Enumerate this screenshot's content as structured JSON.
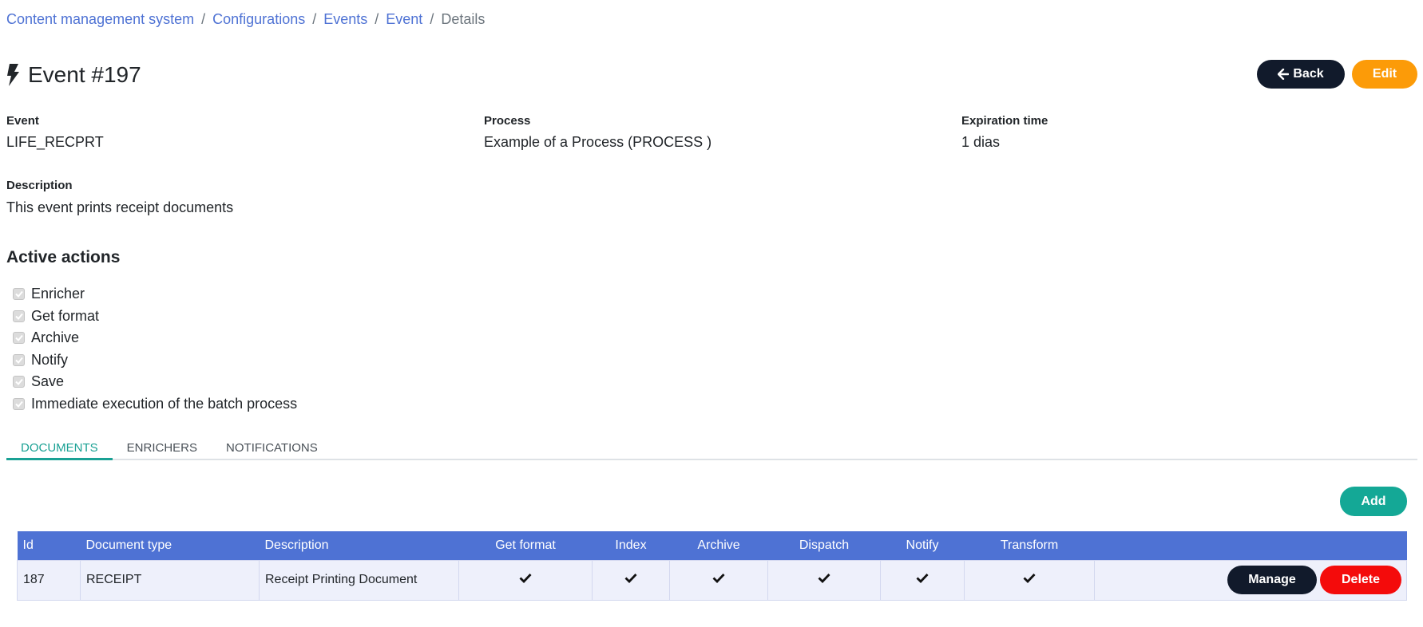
{
  "breadcrumb": {
    "items": [
      "Content management system",
      "Configurations",
      "Events",
      "Event"
    ],
    "current": "Details",
    "separator": "/"
  },
  "page": {
    "title": "Event #197",
    "title_icon": "bolt-icon"
  },
  "header_buttons": {
    "back_label": "Back",
    "back_icon": "arrow-left-icon",
    "edit_label": "Edit"
  },
  "fields": {
    "event_label": "Event",
    "event_value": "LIFE_RECPRT",
    "process_label": "Process",
    "process_value": "Example of a Process (PROCESS )",
    "expiration_label": "Expiration time",
    "expiration_value": "1 dias",
    "description_label": "Description",
    "description_value": "This event prints receipt documents"
  },
  "active_actions": {
    "title": "Active actions",
    "items": [
      {
        "label": "Enricher",
        "checked": true,
        "disabled": true
      },
      {
        "label": "Get format",
        "checked": true,
        "disabled": true
      },
      {
        "label": "Archive",
        "checked": true,
        "disabled": true
      },
      {
        "label": "Notify",
        "checked": true,
        "disabled": true
      },
      {
        "label": "Save",
        "checked": true,
        "disabled": true
      },
      {
        "label": "Immediate execution of the batch process",
        "checked": true,
        "disabled": true
      }
    ]
  },
  "tabs": [
    {
      "label": "DOCUMENTS",
      "active": true
    },
    {
      "label": "ENRICHERS",
      "active": false
    },
    {
      "label": "NOTIFICATIONS",
      "active": false
    }
  ],
  "add_label": "Add",
  "table": {
    "columns": [
      "Id",
      "Document type",
      "Description",
      "Get format",
      "Index",
      "Archive",
      "Dispatch",
      "Notify",
      "Transform",
      ""
    ],
    "rows": [
      {
        "id": "187",
        "document_type": "RECEIPT",
        "description": "Receipt Printing Document",
        "get_format": true,
        "index": true,
        "archive": true,
        "dispatch": true,
        "notify": true,
        "transform": true,
        "manage_label": "Manage",
        "delete_label": "Delete"
      }
    ]
  },
  "colors": {
    "link": "#4e72d4",
    "table_header": "#4e72d4",
    "active_tab": "#1aa194",
    "add_button": "#14a896",
    "edit_button": "#fc9b08",
    "delete_button": "#f40b0b",
    "dark_button": "#111a2b"
  }
}
